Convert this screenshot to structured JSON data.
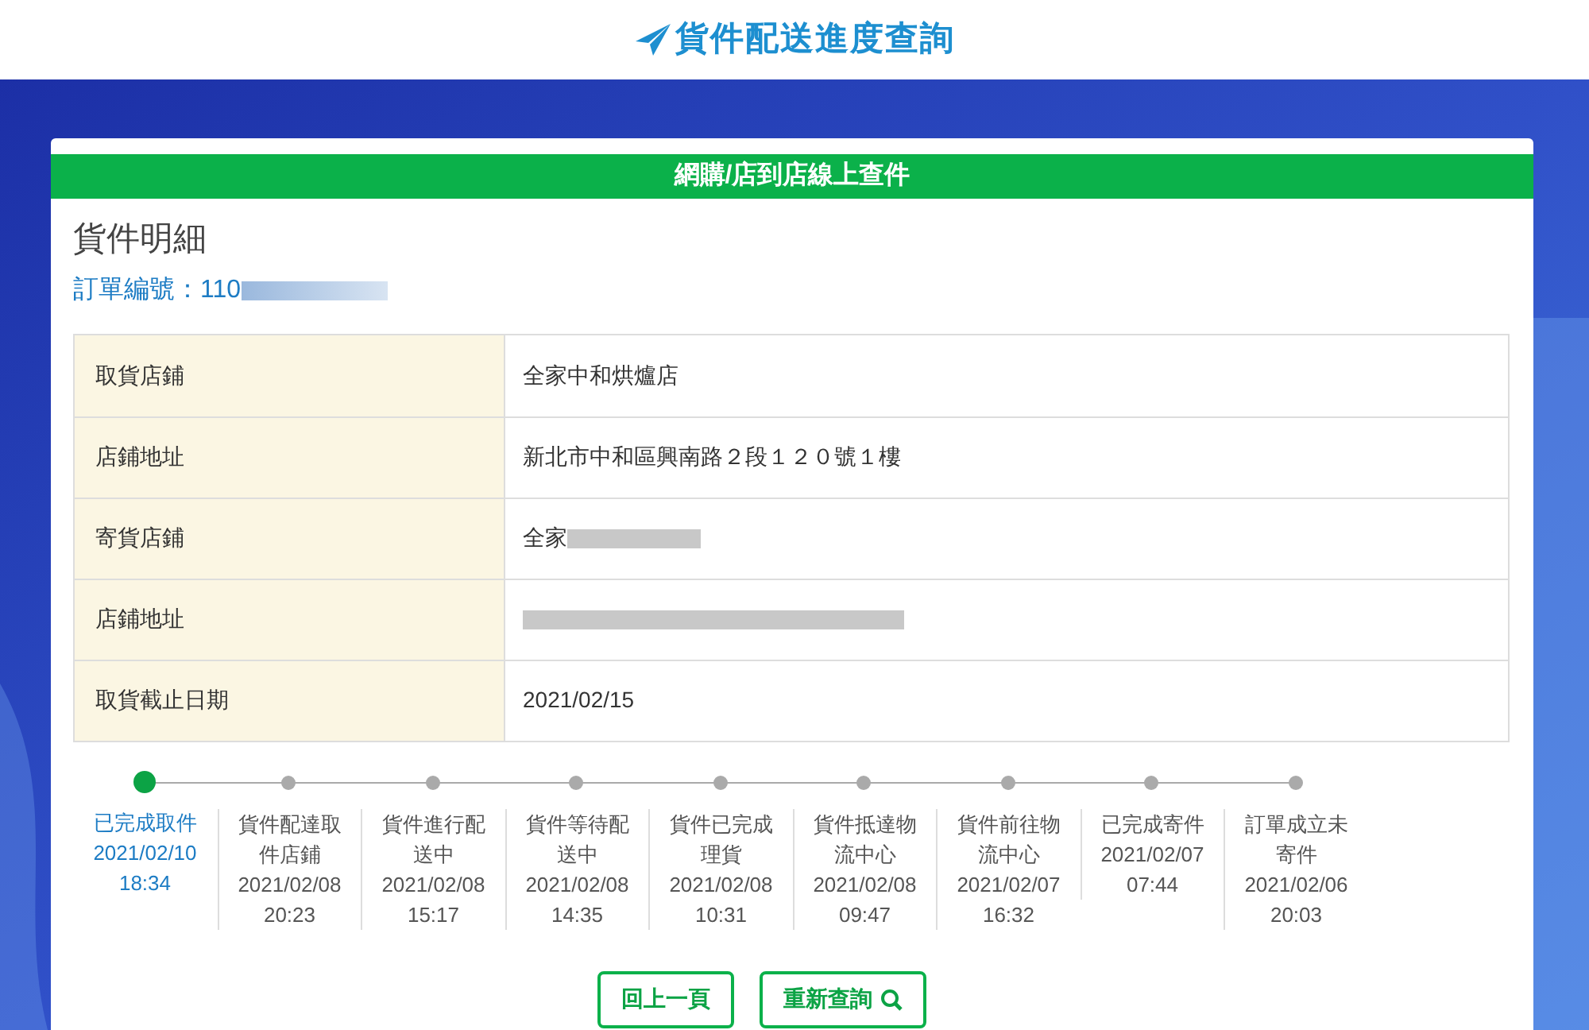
{
  "header": {
    "title": "貨件配送進度查詢"
  },
  "card": {
    "title": "網購/店到店線上查件"
  },
  "detail": {
    "heading": "貨件明細",
    "order_label": "訂單編號：",
    "order_number": "110"
  },
  "rows": [
    {
      "label": "取貨店鋪",
      "value": "全家中和烘爐店",
      "redacted": false
    },
    {
      "label": "店鋪地址",
      "value": "新北市中和區興南路２段１２０號１樓",
      "redacted": false
    },
    {
      "label": "寄貨店鋪",
      "value": "全家",
      "redacted": true
    },
    {
      "label": "店鋪地址",
      "redacted": true
    },
    {
      "label": "取貨截止日期",
      "value": "2021/02/15",
      "redacted": false
    }
  ],
  "steps": [
    {
      "label": "已完成取件",
      "date": "2021/02/10",
      "time": "18:34",
      "selected": true
    },
    {
      "label": "貨件配達取件店鋪",
      "date": "2021/02/08",
      "time": "20:23",
      "selected": false
    },
    {
      "label": "貨件進行配送中",
      "date": "2021/02/08",
      "time": "15:17",
      "selected": false
    },
    {
      "label": "貨件等待配送中",
      "date": "2021/02/08",
      "time": "14:35",
      "selected": false
    },
    {
      "label": "貨件已完成理貨",
      "date": "2021/02/08",
      "time": "10:31",
      "selected": false
    },
    {
      "label": "貨件抵達物流中心",
      "date": "2021/02/08",
      "time": "09:47",
      "selected": false
    },
    {
      "label": "貨件前往物流中心",
      "date": "2021/02/07",
      "time": "16:32",
      "selected": false
    },
    {
      "label": "已完成寄件",
      "date": "2021/02/07",
      "time": "07:44",
      "selected": false
    },
    {
      "label": "訂單成立未寄件",
      "date": "2021/02/06",
      "time": "20:03",
      "selected": false
    }
  ],
  "buttons": [
    {
      "label": "回上一頁",
      "kind": "back"
    },
    {
      "label": "重新查詢",
      "kind": "search"
    }
  ]
}
